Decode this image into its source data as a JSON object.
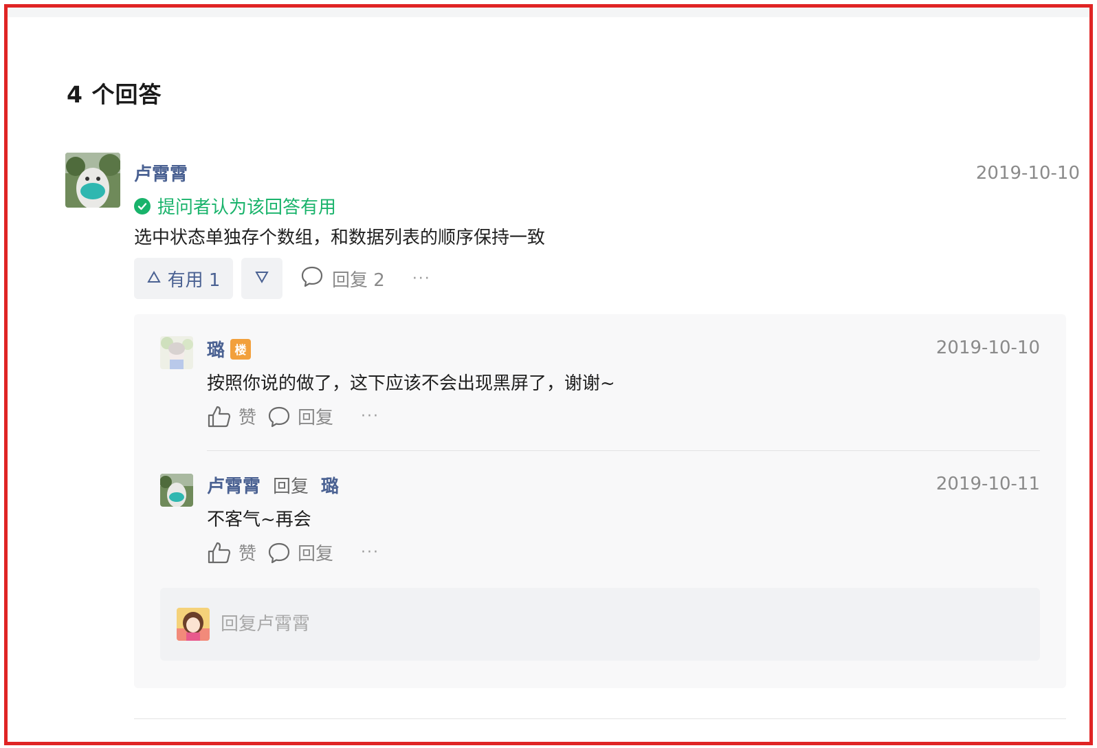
{
  "section": {
    "title": "4 个回答"
  },
  "answer": {
    "author": "卢霄霄",
    "date": "2019-10-10",
    "accepted_text": "提问者认为该回答有用",
    "body": "选中状态单独存个数组，和数据列表的顺序保持一致",
    "upvote_label": "有用 1",
    "reply_label": "回复 2",
    "more_label": "···"
  },
  "comments": [
    {
      "author": "璐",
      "badge": "楼",
      "date": "2019-10-10",
      "text": "按照你说的做了，这下应该不会出现黑屏了，谢谢~",
      "like_label": "赞",
      "reply_label": "回复",
      "more_label": "···"
    },
    {
      "author": "卢霄霄",
      "reply_word": "回复",
      "reply_to": "璐",
      "date": "2019-10-11",
      "text": "不客气~再会",
      "like_label": "赞",
      "reply_label": "回复",
      "more_label": "···"
    }
  ],
  "reply_box": {
    "placeholder": "回复卢霄霄"
  },
  "colors": {
    "link_blue": "#4a6192",
    "accepted_green": "#19b36b",
    "badge_orange": "#f2a03c",
    "frame_red": "#e02424"
  }
}
